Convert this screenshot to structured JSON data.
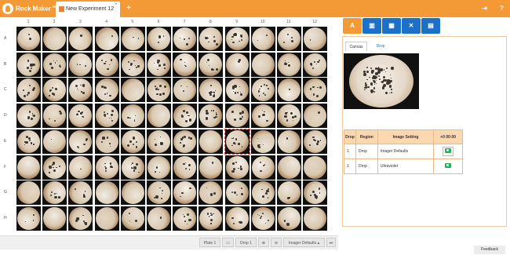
{
  "app": {
    "brand": "Rock Maker",
    "brand_sup": "web"
  },
  "tab": {
    "label": "New Experiment 12",
    "close": "×"
  },
  "plate": {
    "columns": [
      "1",
      "2",
      "3",
      "4",
      "5",
      "6",
      "7",
      "8",
      "9",
      "10",
      "11",
      "12"
    ],
    "rows": [
      "A",
      "B",
      "C",
      "D",
      "E",
      "F",
      "G",
      "H"
    ],
    "selected_well": "E9"
  },
  "bottombar": {
    "plate_label": "Plate 1",
    "drop_label": "Drop 1",
    "imager_label": "Imager Defaults ▴",
    "zoom_in": "⊕",
    "zoom_out": "⊖",
    "last": "⏭"
  },
  "side_tabs": [
    "Canvas",
    "Drop"
  ],
  "image_table": {
    "headers": [
      "Drop",
      "Region",
      "Image Setting",
      "+0 00:00"
    ],
    "rows": [
      {
        "drop": "1",
        "region": "Drop",
        "setting": "Imager Defaults"
      },
      {
        "drop": "1",
        "region": "Drop",
        "setting": "Ultraviolet"
      }
    ]
  },
  "feedback": "Feedback",
  "colors": {
    "accent": "#f39a36",
    "tab_blue": "#1d70c7"
  }
}
